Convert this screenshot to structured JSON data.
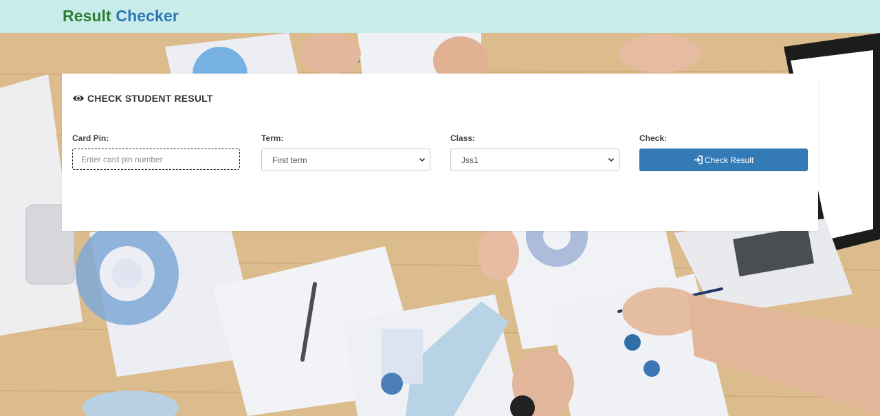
{
  "navbar": {
    "brand_word1": "Result",
    "brand_word2": "Checker"
  },
  "card": {
    "title": "CHECK STUDENT RESULT",
    "title_icon": "eye-icon",
    "fields": {
      "card_pin": {
        "label": "Card Pin:",
        "placeholder": "Enter card pin number",
        "value": ""
      },
      "term": {
        "label": "Term:",
        "selected": "First term"
      },
      "class": {
        "label": "Class:",
        "selected": "Jss1"
      },
      "check": {
        "label": "Check:",
        "button_label": "Check Result",
        "button_icon": "login-icon"
      }
    }
  },
  "colors": {
    "navbar_bg": "#c8ecea",
    "brand_word1": "#2e7d32",
    "brand_word2": "#2f75b5",
    "button_bg": "#337ab7"
  }
}
